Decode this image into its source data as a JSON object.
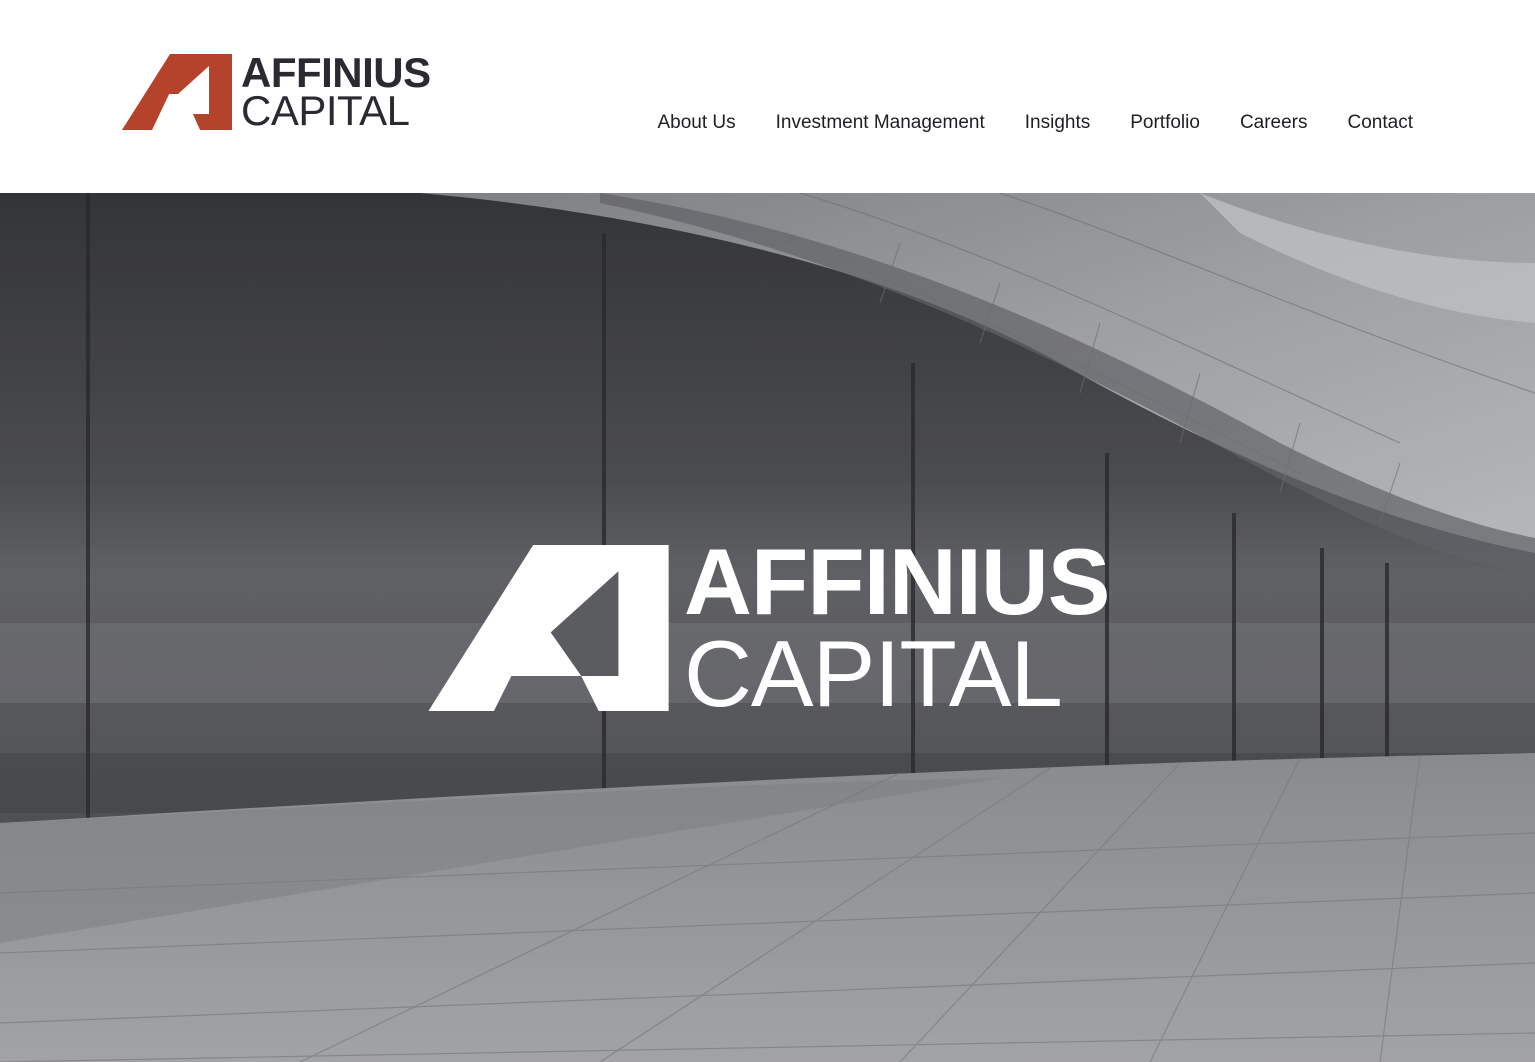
{
  "brand": {
    "name_line_1": "AFFINIUS",
    "name_line_2": "CAPITAL",
    "logo_icon": "affinius-a-mark-icon",
    "mark_color": "#b5432b",
    "text_color": "#2b2a30"
  },
  "nav": {
    "items": [
      {
        "label": "About Us"
      },
      {
        "label": "Investment Management"
      },
      {
        "label": "Insights"
      },
      {
        "label": "Portfolio"
      },
      {
        "label": "Careers"
      },
      {
        "label": "Contact"
      }
    ]
  },
  "hero": {
    "name_line_1": "AFFINIUS",
    "name_line_2": "CAPITAL",
    "logo_icon": "affinius-a-mark-icon",
    "logo_color": "#ffffff",
    "background": "modern-architecture-photo"
  }
}
